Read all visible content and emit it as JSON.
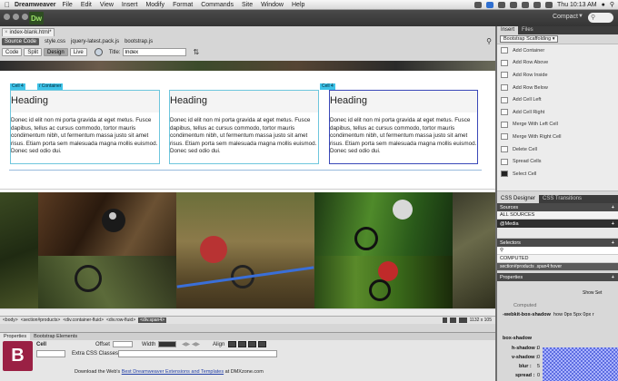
{
  "menubar": {
    "app": "Dreamweaver",
    "items": [
      "File",
      "Edit",
      "View",
      "Insert",
      "Modify",
      "Format",
      "Commands",
      "Site",
      "Window",
      "Help"
    ],
    "clock": "Thu 10:13 AM"
  },
  "header": {
    "logo": "Dw",
    "workspace": "Compact",
    "search": ""
  },
  "document": {
    "tab": "index-blank.html*",
    "related_files": [
      "Source Code",
      "style.css",
      "jquery-latest.pack.js",
      "bootstrap.js"
    ],
    "views": [
      "Code",
      "Split",
      "Design",
      "Live"
    ],
    "active_view": "Design",
    "title_label": "Title:",
    "title_value": "Index"
  },
  "design": {
    "labels": {
      "cell_a": "Cell 4",
      "container": "/ Container",
      "cell_b": "Cell 4"
    },
    "columns": [
      {
        "heading": "Heading",
        "text": "Donec id elit non mi porta gravida at eget metus. Fusce dapibus, tellus ac cursus commodo, tortor mauris condimentum nibh, ut fermentum massa justo sit amet risus. Etiam porta sem malesuada magna mollis euismod. Donec sed odio dui."
      },
      {
        "heading": "Heading",
        "text": "Donec id elit non mi porta gravida at eget metus. Fusce dapibus, tellus ac cursus commodo, tortor mauris condimentum nibh, ut fermentum massa justo sit amet risus. Etiam porta sem malesuada magna mollis euismod. Donec sed odio dui."
      },
      {
        "heading": "Heading",
        "text": "Donec id elit non mi porta gravida at eget metus. Fusce dapibus, tellus ac cursus commodo, tortor mauris condimentum nibh, ut fermentum massa justo sit amet risus. Etiam porta sem malesuada magna mollis euismod. Donec sed odio dui."
      }
    ]
  },
  "tagbar": {
    "tags": [
      "<body>",
      "<section#products>",
      "<div.container-fluid>",
      "<div.row-fluid>"
    ],
    "selected": "<div.span4>",
    "size": "1132 x 105"
  },
  "properties": {
    "tabs": [
      "Properties",
      "Bootstrap Elements"
    ],
    "element": "Cell",
    "offset_label": "Offset",
    "width_label": "Width",
    "align_label": "Align",
    "extra_css_label": "Extra CSS Classes",
    "download_prefix": "Download the Web's ",
    "download_link": "Best Dreamweaver Extensions and Templates",
    "download_suffix": " at DMXzone.com"
  },
  "right_panel": {
    "tabs": [
      "Insert",
      "Files"
    ],
    "category": "Bootstrap Scaffolding",
    "items": [
      "Add Container",
      "Add Row Above",
      "Add Row Inside",
      "Add Row Below",
      "Add Cell Left",
      "Add Cell Right",
      "Merge With Left Cell",
      "Merge With Right Cell",
      "Delete Cell",
      "Spread Cells",
      "Select Cell"
    ],
    "css_tabs": [
      "CSS Designer",
      "CSS Transitions"
    ],
    "sources_label": "Sources",
    "sources_item": "ALL SOURCES",
    "media_label": "@Media",
    "selectors_label": "Selectors",
    "selectors_items": [
      "COMPUTED",
      "section#products .span4:hover"
    ],
    "properties_label": "Properties",
    "show_set": "Show Set",
    "computed": "Computed",
    "box_shadow_prefixed": "-webkit-box-shadow",
    "box_shadow_value": "how 0px 5px 0px r",
    "box_shadow_section": "box-shadow",
    "shadow_fields": [
      "h-shadow :",
      "v-shadow :",
      "blur :",
      "spread :"
    ],
    "shadow_values": [
      "0",
      "0",
      "5",
      "0"
    ]
  }
}
